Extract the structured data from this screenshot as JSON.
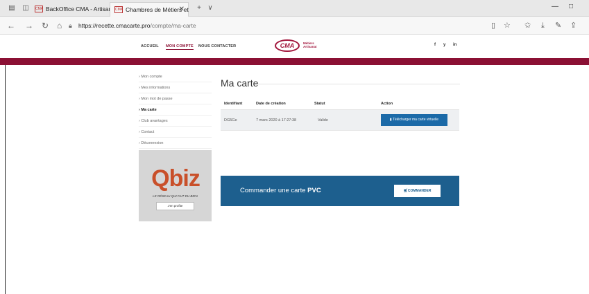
{
  "browser": {
    "tabs": [
      {
        "label": "BackOffice CMA - Artisans",
        "favicon": "CMA"
      },
      {
        "label": "Chambres de Métiers et",
        "favicon": "CMA",
        "active": true
      }
    ],
    "new_tab_icon": "+",
    "tab_menu_icon": "∨",
    "url_host": "https://recette.cmacarte.pro",
    "url_path": "/compte/ma-carte",
    "window_controls": {
      "minimize": "—",
      "maximize": "□"
    }
  },
  "site": {
    "menu": {
      "accueil": "ACCUEIL",
      "mon_compte": "MON COMPTE",
      "nous_contacter": "NOUS CONTACTER"
    },
    "logo": {
      "mark": "CMA",
      "sub": "Métiers Artisanat"
    },
    "social": {
      "facebook": "f",
      "twitter": "y",
      "linkedin": "in"
    },
    "brand_color": "#8b1034"
  },
  "sidebar": {
    "items": [
      {
        "label": "› Mon compte"
      },
      {
        "label": "› Mes informations"
      },
      {
        "label": "› Mon mot de passe"
      },
      {
        "label": "› Ma carte"
      },
      {
        "label": "› Club avantages"
      },
      {
        "label": "› Contact"
      },
      {
        "label": "› Déconnexion"
      }
    ],
    "promo": {
      "brand": "Qbiz",
      "tagline": "LE RÉSEAU QUI FAIT DU BIEN",
      "button": "J'en profite"
    }
  },
  "main": {
    "title": "Ma carte",
    "table": {
      "headers": [
        "Identifiant",
        "Date de création",
        "Statut",
        "Action"
      ],
      "rows": [
        {
          "id": "DG5Ge",
          "date": "7 mars 2020 à 17:27:38",
          "status": "Valide",
          "action": "Télécharger ma carte virtuelle"
        }
      ]
    },
    "cta": {
      "text": "Commander une carte",
      "text_bold": "PVC",
      "button": "COMMANDER",
      "color": "#1d5f8e"
    }
  }
}
